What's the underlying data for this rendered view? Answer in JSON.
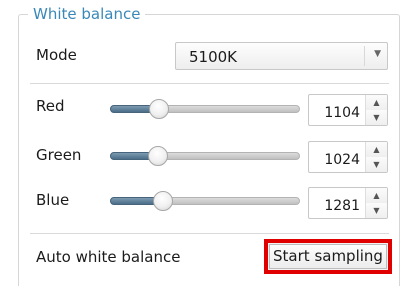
{
  "group": {
    "title": "White balance"
  },
  "mode": {
    "label": "Mode",
    "value": "5100K"
  },
  "channels": [
    {
      "label": "Red",
      "value": "1104",
      "level": 0.26
    },
    {
      "label": "Green",
      "value": "1024",
      "level": 0.25
    },
    {
      "label": "Blue",
      "value": "1281",
      "level": 0.28
    }
  ],
  "auto": {
    "label": "Auto white balance",
    "button_label": "Start sampling"
  },
  "icons": {
    "combo_arrow": "chevron-down-icon",
    "spin_up": "arrow-up-icon",
    "spin_down": "arrow-down-icon"
  },
  "colors": {
    "legend": "#3a88b8",
    "highlight": "#e00000"
  }
}
